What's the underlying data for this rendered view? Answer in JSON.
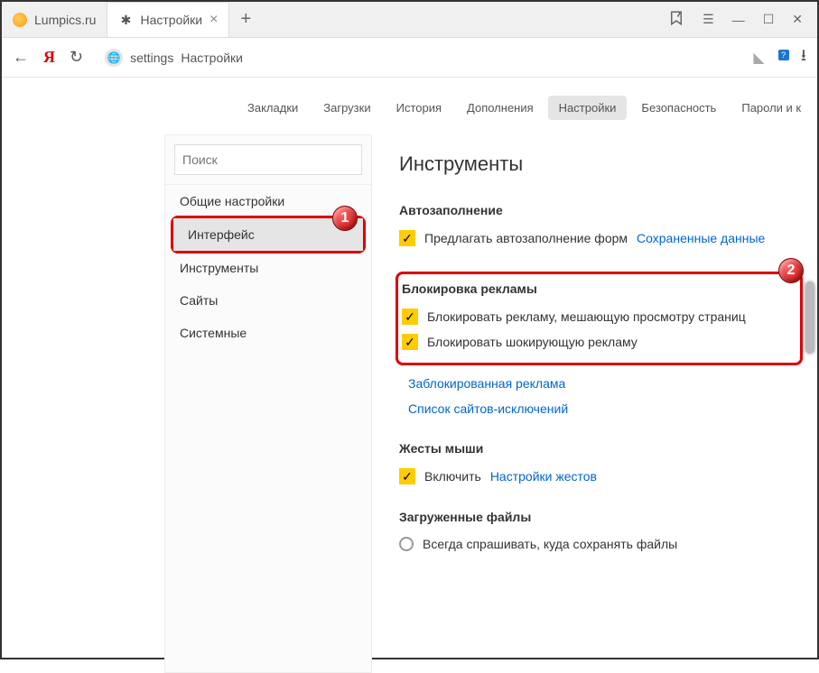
{
  "tabs": [
    {
      "label": "Lumpics.ru"
    },
    {
      "label": "Настройки"
    }
  ],
  "address": {
    "left": "settings",
    "right": "Настройки"
  },
  "nav": {
    "items": [
      "Закладки",
      "Загрузки",
      "История",
      "Дополнения",
      "Настройки",
      "Безопасность",
      "Пароли и к"
    ]
  },
  "sidebar": {
    "search_placeholder": "Поиск",
    "items": [
      "Общие настройки",
      "Интерфейс",
      "Инструменты",
      "Сайты",
      "Системные"
    ]
  },
  "content": {
    "page_title": "Инструменты",
    "autofill": {
      "title": "Автозаполнение",
      "checkbox": "Предлагать автозаполнение форм",
      "link": "Сохраненные данные"
    },
    "adblock": {
      "title": "Блокировка рекламы",
      "cb1": "Блокировать рекламу, мешающую просмотру страниц",
      "cb2": "Блокировать шокирующую рекламу",
      "link1": "Заблокированная реклама",
      "link2": "Список сайтов-исключений"
    },
    "gestures": {
      "title": "Жесты мыши",
      "checkbox": "Включить",
      "link": "Настройки жестов"
    },
    "downloads": {
      "title": "Загруженные файлы",
      "radio": "Всегда спрашивать, куда сохранять файлы"
    }
  },
  "annotations": {
    "badge1": "1",
    "badge2": "2"
  }
}
